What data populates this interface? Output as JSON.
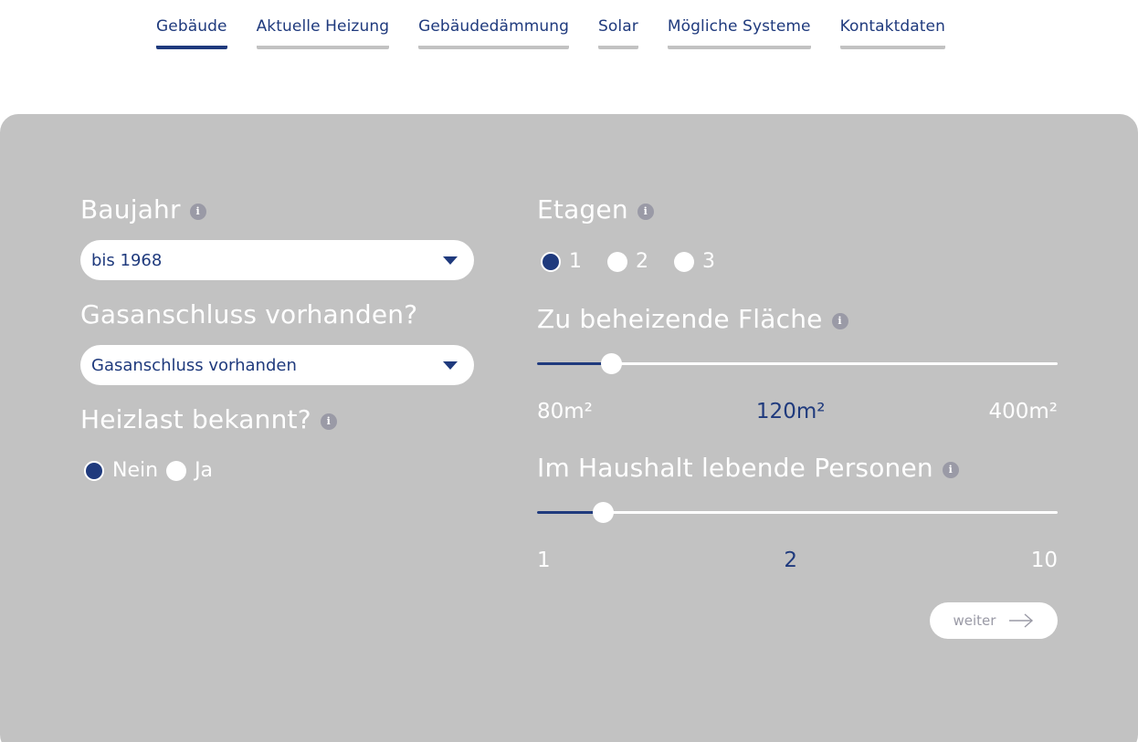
{
  "tabs": [
    {
      "label": "Gebäude",
      "active": true
    },
    {
      "label": "Aktuelle Heizung",
      "active": false
    },
    {
      "label": "Gebäudedämmung",
      "active": false
    },
    {
      "label": "Solar",
      "active": false
    },
    {
      "label": "Mögliche Systeme",
      "active": false
    },
    {
      "label": "Kontaktdaten",
      "active": false
    }
  ],
  "form": {
    "baujahr": {
      "label": "Baujahr",
      "value": "bis 1968"
    },
    "gas": {
      "label": "Gasanschluss vorhanden?",
      "value": "Gasanschluss vorhanden"
    },
    "heizlast": {
      "label": "Heizlast bekannt?",
      "options": [
        "Nein",
        "Ja"
      ],
      "selected": "Nein"
    },
    "etagen": {
      "label": "Etagen",
      "options": [
        "1",
        "2",
        "3"
      ],
      "selected": "1"
    },
    "flaeche": {
      "label": "Zu beheizende Fläche",
      "min": "80m²",
      "value": "120m²",
      "max": "400m²",
      "min_num": 80,
      "max_num": 400,
      "value_num": 120
    },
    "personen": {
      "label": "Im Haushalt lebende Personen",
      "min": "1",
      "value": "2",
      "max": "10",
      "min_num": 1,
      "max_num": 10,
      "value_num": 2
    },
    "next_label": "weiter"
  },
  "icons": {
    "info": "info-icon",
    "caret": "caret-down-icon",
    "arrow": "arrow-right-icon"
  },
  "colors": {
    "accent": "#1f3a7d",
    "panel": "#c2c2c2",
    "info": "#9a9aa6"
  }
}
